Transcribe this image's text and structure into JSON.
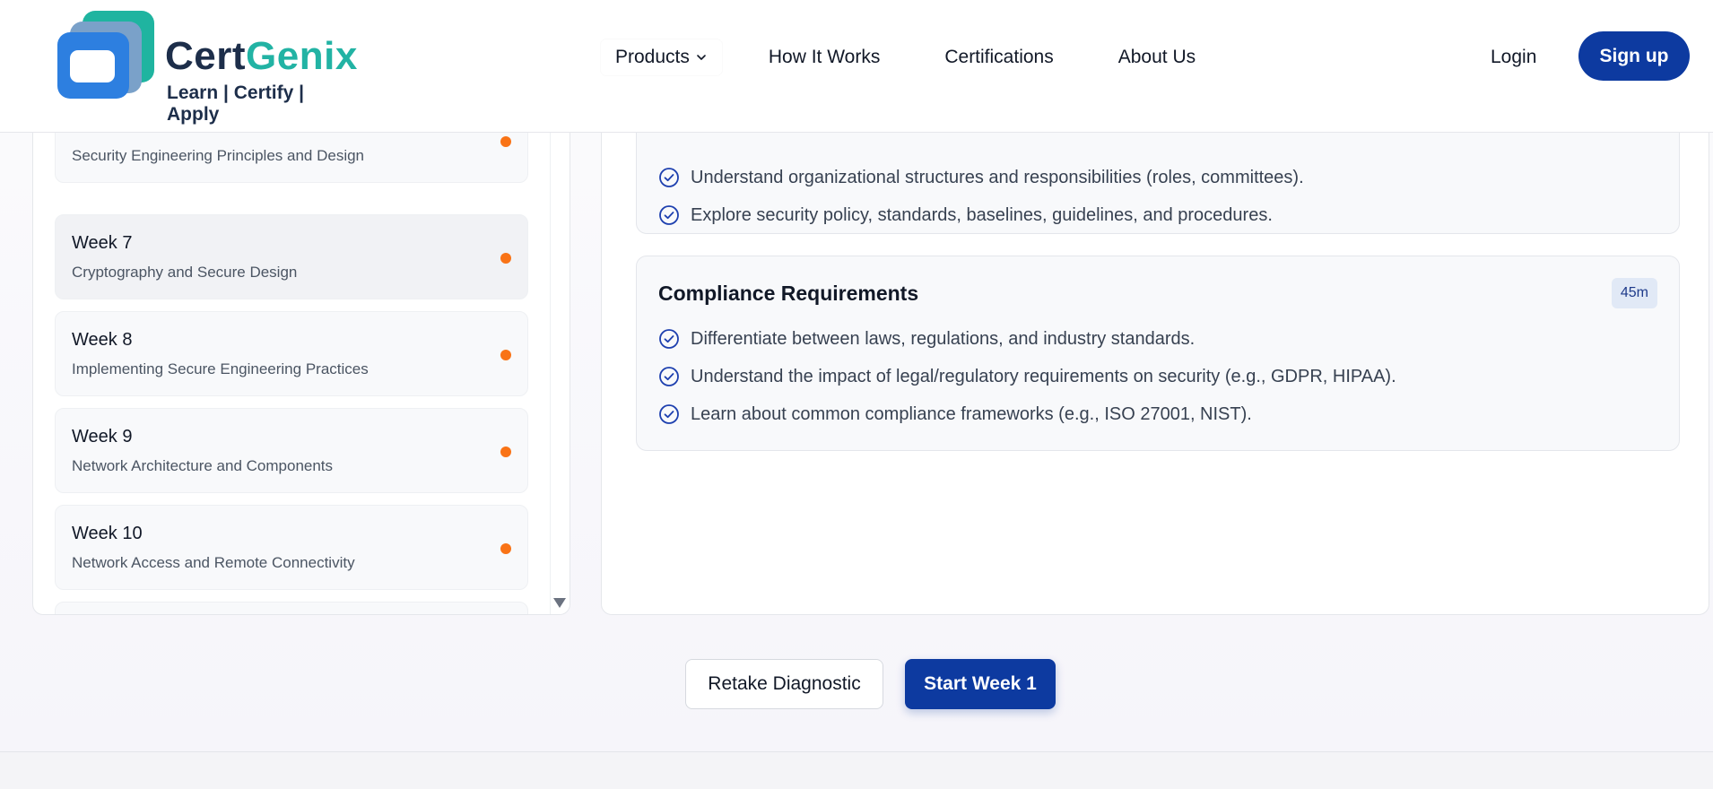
{
  "header": {
    "logo": {
      "word_part1": "Cert",
      "word_part2": "Genix",
      "tagline": "Learn | Certify | Apply"
    },
    "nav": [
      {
        "label": "Products",
        "has_dropdown": true
      },
      {
        "label": "How It Works"
      },
      {
        "label": "Certifications"
      },
      {
        "label": "About Us"
      }
    ],
    "login_label": "Login",
    "signup_label": "Sign up"
  },
  "weeks": [
    {
      "title": "Week 6",
      "subtitle": "Security Engineering Principles and Design",
      "status_color": "#f97316"
    },
    {
      "title": "Week 7",
      "subtitle": "Cryptography and Secure Design",
      "status_color": "#f97316",
      "active": true
    },
    {
      "title": "Week 8",
      "subtitle": "Implementing Secure Engineering Practices",
      "status_color": "#f97316"
    },
    {
      "title": "Week 9",
      "subtitle": "Network Architecture and Components",
      "status_color": "#f97316"
    },
    {
      "title": "Week 10",
      "subtitle": "Network Access and Remote Connectivity",
      "status_color": "#f97316"
    }
  ],
  "topics": [
    {
      "objectives": [
        "Understand organizational structures and responsibilities (roles, committees).",
        "Explore security policy, standards, baselines, guidelines, and procedures."
      ]
    },
    {
      "title": "Compliance Requirements",
      "duration": "45m",
      "objectives": [
        "Differentiate between laws, regulations, and industry standards.",
        "Understand the impact of legal/regulatory requirements on security (e.g., GDPR, HIPAA).",
        "Learn about common compliance frameworks (e.g., ISO 27001, NIST)."
      ]
    }
  ],
  "actions": {
    "retake_label": "Retake Diagnostic",
    "start_label": "Start Week 1"
  },
  "colors": {
    "primary": "#0d3aa0",
    "brand_teal": "#22b3a4",
    "brand_navy": "#1d2e4a",
    "status_orange": "#f97316"
  },
  "icons": [
    "logo-mark-icon",
    "chevron-down-icon",
    "check-circle-icon",
    "scroll-down-arrow-icon"
  ]
}
